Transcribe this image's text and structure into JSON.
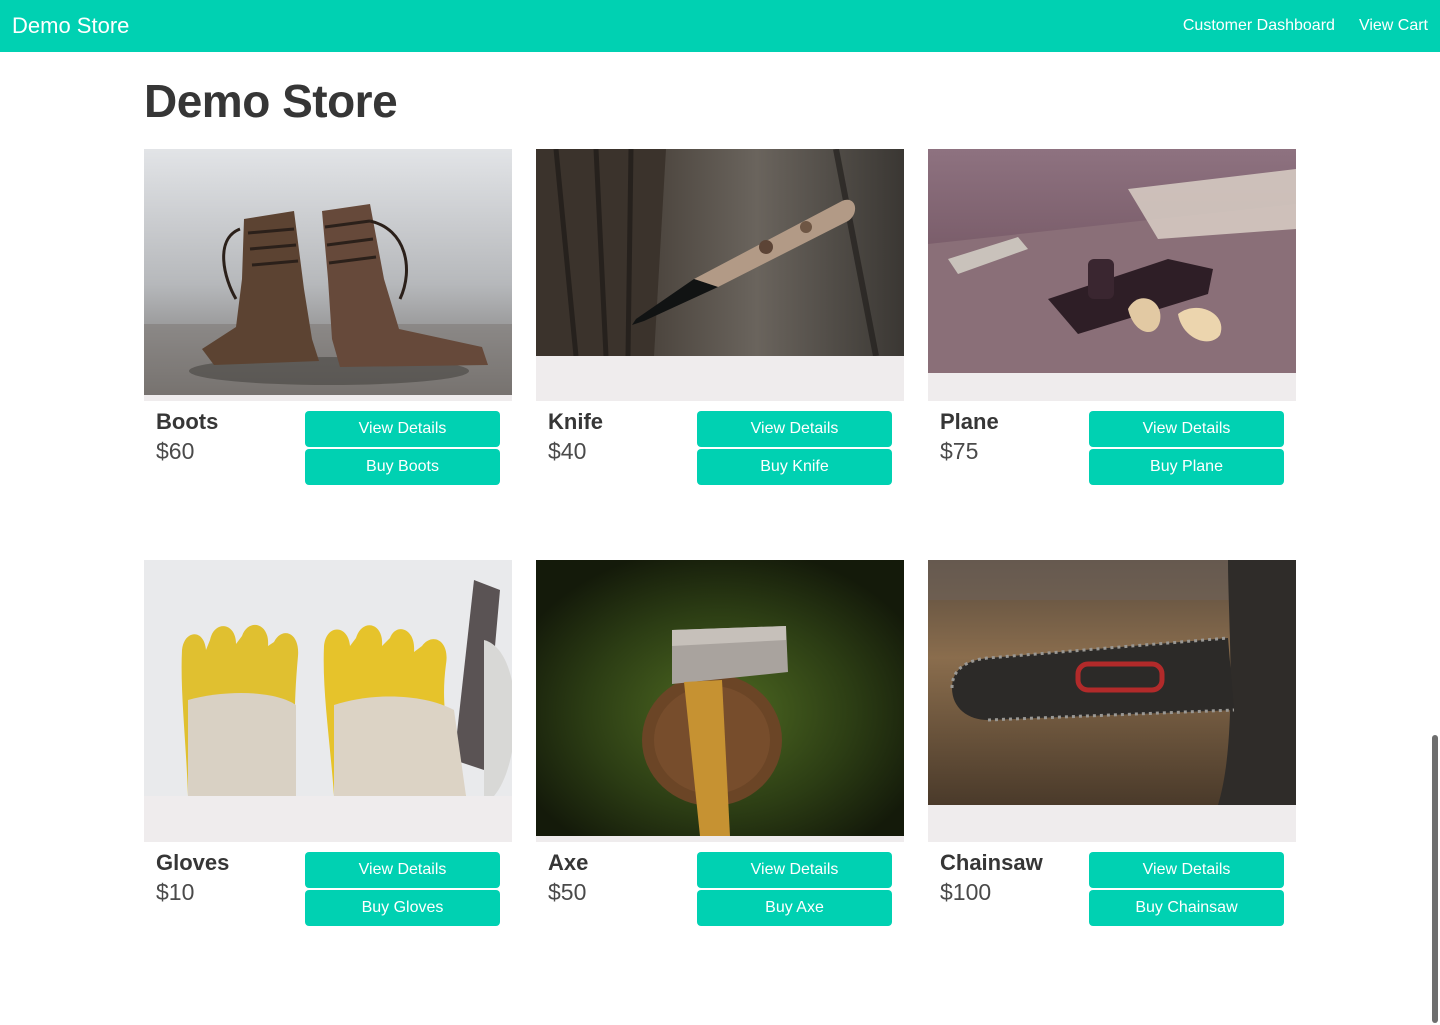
{
  "nav": {
    "brand": "Demo Store",
    "links": [
      "Customer Dashboard",
      "View Cart"
    ]
  },
  "page": {
    "title": "Demo Store"
  },
  "products": [
    {
      "name": "Boots",
      "price": "$60",
      "view_label": "View Details",
      "buy_label": "Buy Boots",
      "image": "boots-photo"
    },
    {
      "name": "Knife",
      "price": "$40",
      "view_label": "View Details",
      "buy_label": "Buy Knife",
      "image": "knife-photo"
    },
    {
      "name": "Plane",
      "price": "$75",
      "view_label": "View Details",
      "buy_label": "Buy Plane",
      "image": "plane-photo"
    },
    {
      "name": "Gloves",
      "price": "$10",
      "view_label": "View Details",
      "buy_label": "Buy Gloves",
      "image": "gloves-photo"
    },
    {
      "name": "Axe",
      "price": "$50",
      "view_label": "View Details",
      "buy_label": "Buy Axe",
      "image": "axe-photo"
    },
    {
      "name": "Chainsaw",
      "price": "$100",
      "view_label": "View Details",
      "buy_label": "Buy Chainsaw",
      "image": "chainsaw-photo"
    }
  ],
  "colors": {
    "primary": "#00d1b2",
    "text": "#363636",
    "image_placeholder": "#efeced"
  }
}
